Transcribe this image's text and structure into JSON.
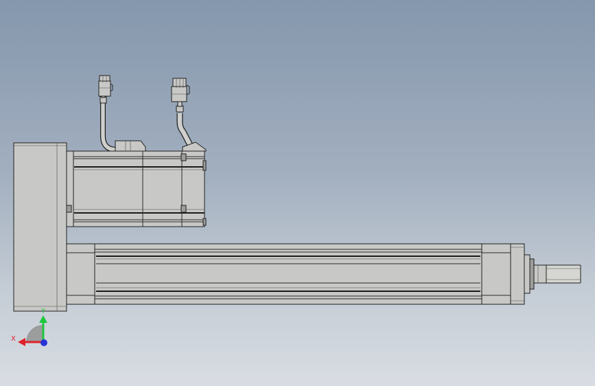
{
  "view": {
    "background_top": "#8597ad",
    "background_bottom": "#d9dde3"
  },
  "model": {
    "part_color": "#c8c8c6",
    "edge_color": "#1f1f1f",
    "components": [
      "servo-motor",
      "motor-adapter-plate",
      "actuator-body",
      "piston-rod",
      "encoder-connector",
      "power-connector"
    ]
  },
  "triad": {
    "x_label": "X",
    "y_label": "Y",
    "x_color": "#e0202a",
    "y_color": "#1ec83c",
    "z_color": "#2535d6"
  }
}
